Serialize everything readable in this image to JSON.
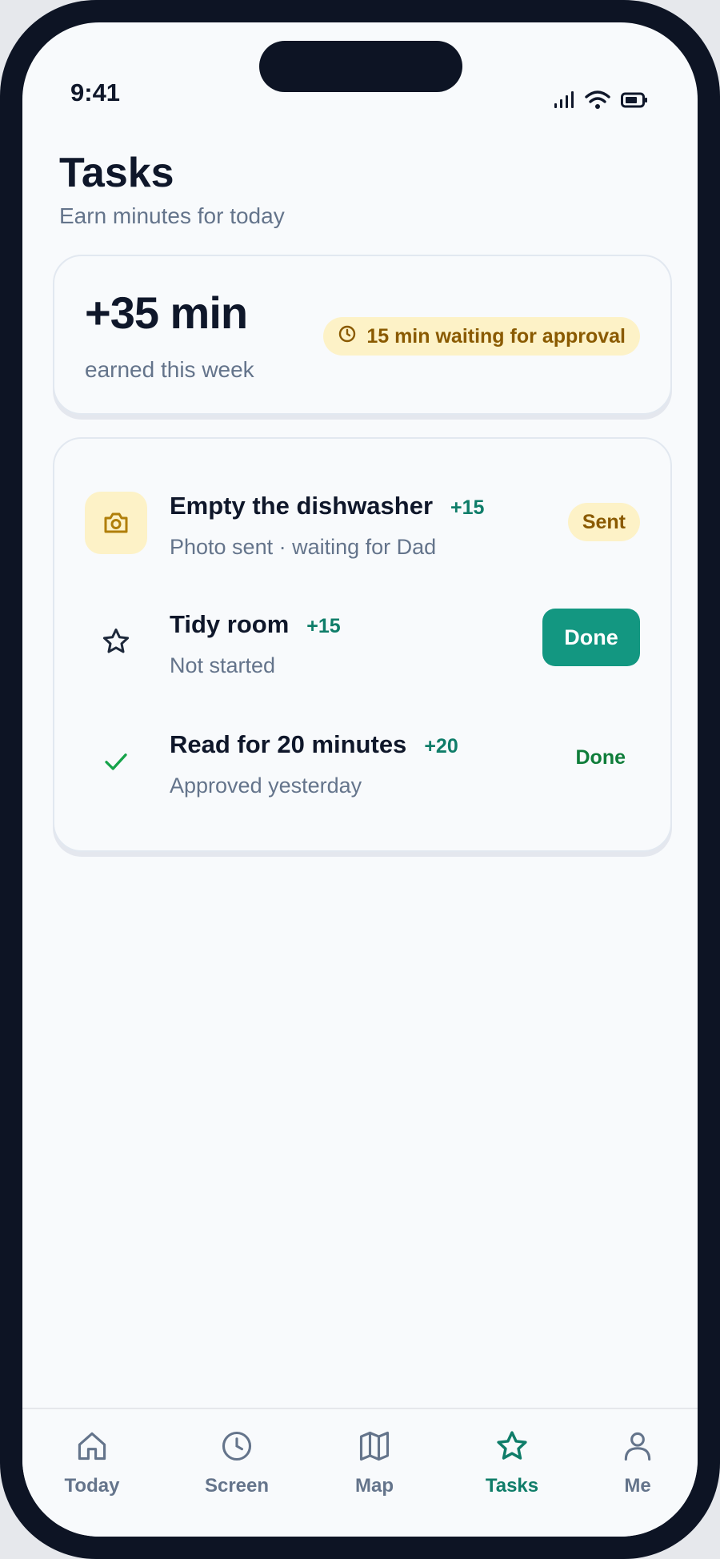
{
  "status_bar": {
    "time": "9:41"
  },
  "header": {
    "title": "Tasks",
    "subtitle": "Earn minutes for today"
  },
  "summary": {
    "earned": "+35 min",
    "earned_label": "earned this week",
    "pending": "15 min waiting for approval"
  },
  "tasks": [
    {
      "name": "Empty the dishwasher",
      "points": "+15",
      "status": "Photo sent · waiting for Dad",
      "action": "Sent",
      "icon": "camera-icon"
    },
    {
      "name": "Tidy room",
      "points": "+15",
      "status": "Not started",
      "action": "Done",
      "icon": "star-icon"
    },
    {
      "name": "Read for 20 minutes",
      "points": "+20",
      "status": "Approved yesterday",
      "action": "Done",
      "icon": "check-icon"
    }
  ],
  "tabbar": {
    "items": [
      {
        "label": "Today",
        "icon": "home-icon"
      },
      {
        "label": "Screen",
        "icon": "clock-icon"
      },
      {
        "label": "Map",
        "icon": "map-icon"
      },
      {
        "label": "Tasks",
        "icon": "star-icon",
        "active": true
      },
      {
        "label": "Me",
        "icon": "person-icon"
      }
    ]
  },
  "colors": {
    "accent": "#139781",
    "pending_bg": "#fdf2c7",
    "pending_text": "#8a5a00",
    "approved": "#0f7d3a"
  }
}
